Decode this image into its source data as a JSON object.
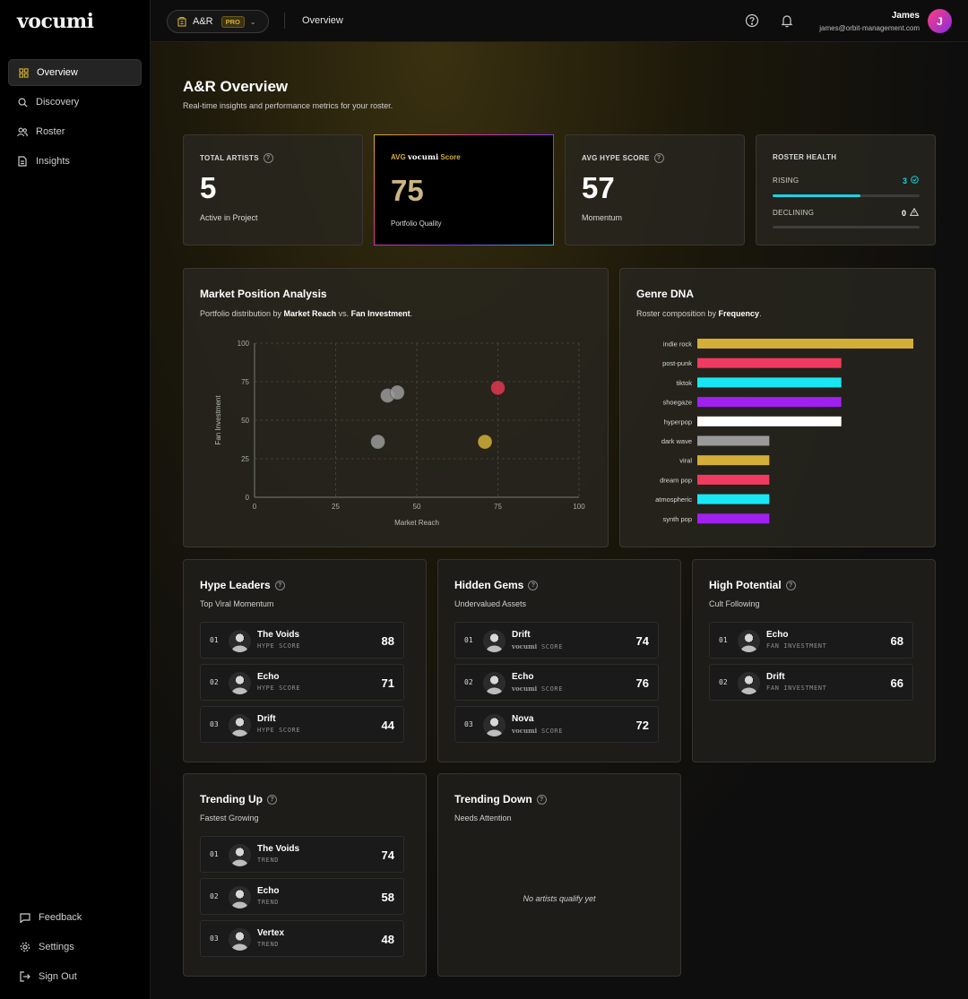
{
  "app": {
    "logo": "vocumi"
  },
  "sidebar": {
    "items": [
      {
        "label": "Overview",
        "icon": "grid-icon",
        "active": true
      },
      {
        "label": "Discovery",
        "icon": "search-icon"
      },
      {
        "label": "Roster",
        "icon": "users-icon"
      },
      {
        "label": "Insights",
        "icon": "document-icon"
      }
    ],
    "bottom": [
      {
        "label": "Feedback",
        "icon": "message-icon"
      },
      {
        "label": "Settings",
        "icon": "gear-icon"
      },
      {
        "label": "Sign Out",
        "icon": "logout-icon"
      }
    ]
  },
  "topbar": {
    "project": "A&R",
    "badge": "PRO",
    "breadcrumb": "Overview",
    "user_name": "James",
    "user_email": "james@orbit-management.com",
    "avatar_initial": "J"
  },
  "page": {
    "title": "A&R Overview",
    "subtitle": "Real-time insights and performance metrics for your roster."
  },
  "stats": {
    "total_artists": {
      "label": "TOTAL ARTISTS",
      "value": "5",
      "caption": "Active in Project"
    },
    "avg_score": {
      "prefix": "AVG",
      "brand": "vocumi",
      "suffix": "Score",
      "value": "75",
      "caption": "Portfolio Quality"
    },
    "avg_hype": {
      "label": "AVG HYPE SCORE",
      "value": "57",
      "caption": "Momentum"
    },
    "roster_health": {
      "label": "ROSTER HEALTH",
      "rising_label": "RISING",
      "rising_value": "3",
      "rising_fraction": 0.6,
      "declining_label": "DECLINING",
      "declining_value": "0",
      "declining_fraction": 0
    }
  },
  "market": {
    "title": "Market Position Analysis",
    "sub_prefix": "Portfolio distribution by ",
    "sub_a": "Market Reach",
    "sub_mid": " vs. ",
    "sub_b": "Fan Investment",
    "sub_end": "."
  },
  "genre": {
    "title": "Genre DNA",
    "sub_prefix": "Roster composition by ",
    "sub_b": "Frequency",
    "sub_end": "."
  },
  "chart_data": [
    {
      "type": "scatter",
      "xlabel": "Market Reach",
      "ylabel": "Fan Investment",
      "xlim": [
        0,
        100
      ],
      "ylim": [
        0,
        100
      ],
      "xticks": [
        0,
        25,
        50,
        75,
        100
      ],
      "yticks": [
        0,
        25,
        50,
        75,
        100
      ],
      "grid": true,
      "points": [
        {
          "x": 41,
          "y": 66,
          "color": "#9a9a9a"
        },
        {
          "x": 44,
          "y": 68,
          "color": "#9a9a9a"
        },
        {
          "x": 75,
          "y": 71,
          "color": "#e0384f"
        },
        {
          "x": 38,
          "y": 36,
          "color": "#9a9a9a"
        },
        {
          "x": 71,
          "y": 36,
          "color": "#d4af37"
        }
      ]
    },
    {
      "type": "bar",
      "orientation": "horizontal",
      "categories": [
        "indie rock",
        "post-punk",
        "tiktok",
        "shoegaze",
        "hyperpop",
        "dark wave",
        "viral",
        "dream pop",
        "atmospheric",
        "synth pop"
      ],
      "values": [
        3,
        2,
        2,
        2,
        2,
        1,
        1,
        1,
        1,
        1
      ],
      "colors": [
        "#d4af37",
        "#f03a5f",
        "#19e6f5",
        "#a020f0",
        "#ffffff",
        "#9a9a9a",
        "#d4af37",
        "#f03a5f",
        "#19e6f5",
        "#a020f0"
      ],
      "xlim": [
        0,
        3
      ]
    }
  ],
  "hype_leaders": {
    "title": "Hype Leaders",
    "subtitle": "Top Viral Momentum",
    "rows": [
      {
        "rank": "01",
        "name": "The Voids",
        "metric": "HYPE SCORE",
        "value": "88"
      },
      {
        "rank": "02",
        "name": "Echo",
        "metric": "HYPE SCORE",
        "value": "71"
      },
      {
        "rank": "03",
        "name": "Drift",
        "metric": "HYPE SCORE",
        "value": "44"
      }
    ]
  },
  "hidden_gems": {
    "title": "Hidden Gems",
    "subtitle": "Undervalued Assets",
    "metric_brand": "vocumi",
    "metric_suffix": " SCORE",
    "rows": [
      {
        "rank": "01",
        "name": "Drift",
        "value": "74"
      },
      {
        "rank": "02",
        "name": "Echo",
        "value": "76"
      },
      {
        "rank": "03",
        "name": "Nova",
        "value": "72"
      }
    ]
  },
  "high_potential": {
    "title": "High Potential",
    "subtitle": "Cult Following",
    "rows": [
      {
        "rank": "01",
        "name": "Echo",
        "metric": "FAN INVESTMENT",
        "value": "68"
      },
      {
        "rank": "02",
        "name": "Drift",
        "metric": "FAN INVESTMENT",
        "value": "66"
      }
    ]
  },
  "trending_up": {
    "title": "Trending Up",
    "subtitle": "Fastest Growing",
    "rows": [
      {
        "rank": "01",
        "name": "The Voids",
        "metric": "TREND",
        "value": "74"
      },
      {
        "rank": "02",
        "name": "Echo",
        "metric": "TREND",
        "value": "58"
      },
      {
        "rank": "03",
        "name": "Vertex",
        "metric": "TREND",
        "value": "48"
      }
    ]
  },
  "trending_down": {
    "title": "Trending Down",
    "subtitle": "Needs Attention",
    "empty": "No artists qualify yet"
  },
  "colors": {
    "accent": "#d4af37",
    "rising": "#19d3e6",
    "background": "#0b0b0b"
  }
}
